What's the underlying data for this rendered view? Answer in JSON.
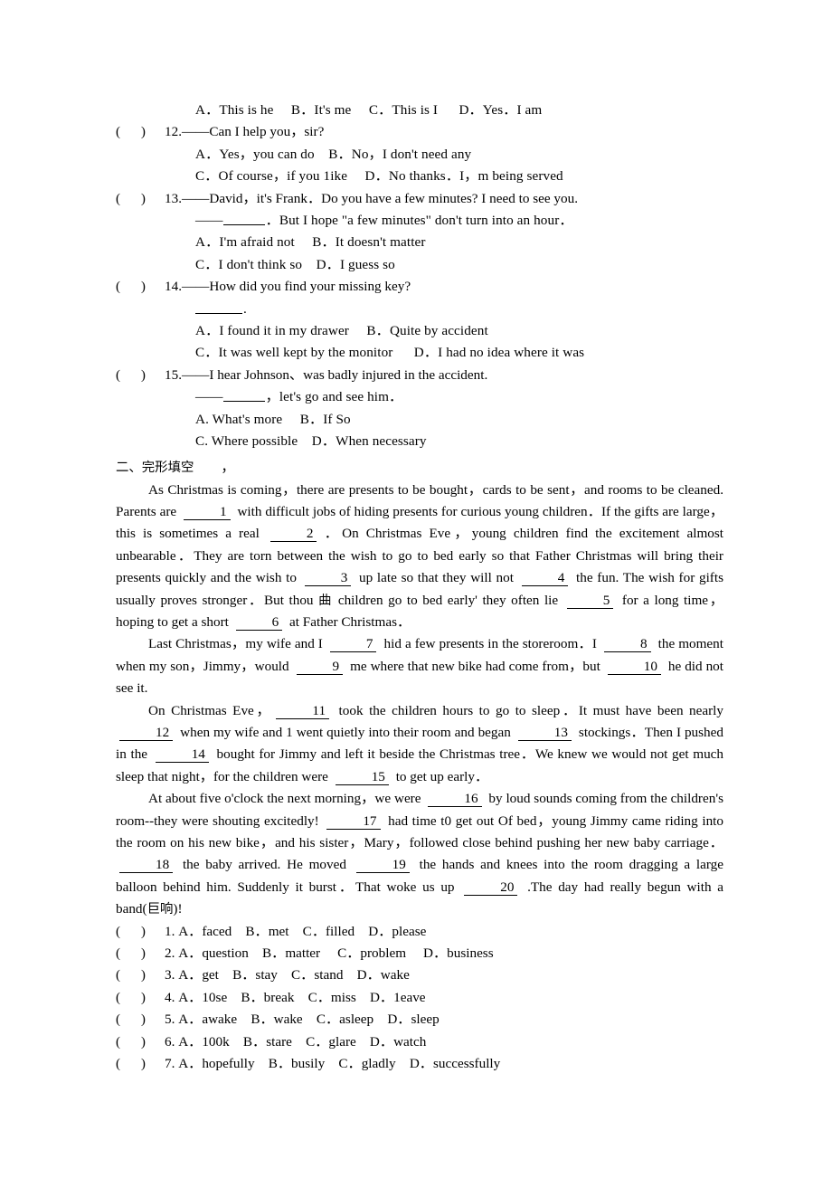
{
  "document": {
    "section_heading": "二、完形填空",
    "section_heading_trailing": "，"
  },
  "multiple_choice": {
    "q11_options": "A．This is he     B．It's me     C．This is I      D．Yes．I am",
    "items": [
      {
        "mark": "(      )",
        "number": "12.",
        "stem": "——Can I help you，sir?",
        "option_lines": [
          "A．Yes，you can do    B．No，I don't need any",
          "C．Of course，if you 1ike     D．No thanks．I，m being served"
        ]
      },
      {
        "mark": "(      )",
        "number": "13.",
        "stem": "——David，it's Frank．Do you have a few minutes? I need to see you.",
        "sub_line_prefix": "——",
        "sub_line_suffix": "．But I hope \"a few minutes\" don't turn into an hour．",
        "option_lines": [
          "A．I'm afraid not     B．It doesn't matter",
          "C．I don't think so    D．I guess so"
        ]
      },
      {
        "mark": "(      )",
        "number": "14.",
        "stem": "——How did you find your missing key?",
        "sub_line_suffix": ".",
        "option_lines": [
          "A．I found it in my drawer     B．Quite by accident",
          "C．It was well kept by the monitor      D．I had no idea where it was"
        ]
      },
      {
        "mark": "(      )",
        "number": "15.",
        "stem": "——I hear Johnson、was badly injured in the accident.",
        "sub_line_prefix": "——",
        "sub_line_suffix": "，let's go and see him．",
        "option_lines": [
          "A. What's more     B．If So",
          "C. Where possible    D．When necessary"
        ]
      }
    ]
  },
  "cloze": {
    "paragraphs": [
      {
        "indent": true,
        "segments": [
          {
            "t": "As Christmas is coming，there are presents to be bought，cards to be sent，and rooms to be cleaned. Parents are "
          },
          {
            "blank": "1"
          },
          {
            "t": " with difficult jobs of hiding presents for curious young children．If the gifts are large，this is sometimes a real "
          },
          {
            "blank": "2"
          },
          {
            "t": "．On Christmas Eve，young children find the excitement almost unbearable．They are torn between the wish to go to bed early so that Father Christmas will bring their presents quickly and the wish to "
          },
          {
            "blank": "3"
          },
          {
            "t": " up late so that they will not "
          },
          {
            "blank": "4"
          },
          {
            "t": " the fun. The wish for gifts usually proves stronger．But thou "
          },
          {
            "cjk": "曲"
          },
          {
            "t": " children go to bed early' they often lie "
          },
          {
            "blank": "5"
          },
          {
            "t": " for a long time，hoping to get a short "
          },
          {
            "blank": "6"
          },
          {
            "t": " at Father Christmas．"
          }
        ]
      },
      {
        "indent": true,
        "segments": [
          {
            "t": "Last Christmas，my wife and I "
          },
          {
            "blank": "7"
          },
          {
            "t": " hid a few presents in the storeroom．I "
          },
          {
            "blank": "8"
          },
          {
            "t": " the moment when my son，Jimmy，would "
          },
          {
            "blank": "9"
          },
          {
            "t": " me where that new bike had come from，but "
          },
          {
            "blank": "10"
          },
          {
            "t": " he did not see it."
          }
        ]
      },
      {
        "indent": true,
        "segments": [
          {
            "t": "On Christmas Eve，"
          },
          {
            "blank": "11"
          },
          {
            "t": " took the children hours to go to sleep．It must have been nearly "
          },
          {
            "blank": "12"
          },
          {
            "t": " when my wife and 1 went quietly into their room and began "
          },
          {
            "blank": "13"
          },
          {
            "t": " stockings．Then I pushed in the "
          },
          {
            "blank": "14"
          },
          {
            "t": " bought for Jimmy and left it beside the Christmas tree．We knew we would not get much  sleep that night，for the children were "
          },
          {
            "blank": "15"
          },
          {
            "t": " to get up early．"
          }
        ]
      },
      {
        "indent": true,
        "segments": [
          {
            "t": "At about five o'clock the next morning，we were "
          },
          {
            "blank": "16"
          },
          {
            "t": " by loud sounds coming from the children's room--they were shouting excitedly! "
          },
          {
            "blank": "17"
          },
          {
            "t": " had time t0 get out Of bed，young Jimmy came riding into the room on his new bike，and his sister，Mary，followed close behind pushing her new baby carriage．"
          },
          {
            "blank": "18"
          },
          {
            "t": " the baby arrived. He moved "
          },
          {
            "blank": "19"
          },
          {
            "t": " the hands and knees into the room dragging a large balloon behind him. Suddenly it burst．That woke us up "
          },
          {
            "blank": "20"
          },
          {
            "t": " .The day had really begun with a band("
          },
          {
            "cjk": "巨响"
          },
          {
            "t": ")!"
          }
        ]
      }
    ],
    "answer_items": [
      {
        "mark": "(      )",
        "number": "1.",
        "options": "A．faced    B．met    C．filled    D．please"
      },
      {
        "mark": "(      )",
        "number": "2.",
        "options": "A．question    B．matter     C．problem     D．business"
      },
      {
        "mark": "(      )",
        "number": "3.",
        "options": "A．get    B．stay    C．stand    D．wake"
      },
      {
        "mark": "(      )",
        "number": "4.",
        "options": "A．10se    B．break    C．miss    D．1eave"
      },
      {
        "mark": "(      )",
        "number": "5.",
        "options": "A．awake    B．wake    C．asleep    D．sleep"
      },
      {
        "mark": "(      )",
        "number": "6.",
        "options": "A．100k    B．stare    C．glare    D．watch"
      },
      {
        "mark": "(      )",
        "number": "7.",
        "options": "A．hopefully    B．busily    C．gladly    D．successfully"
      }
    ]
  }
}
